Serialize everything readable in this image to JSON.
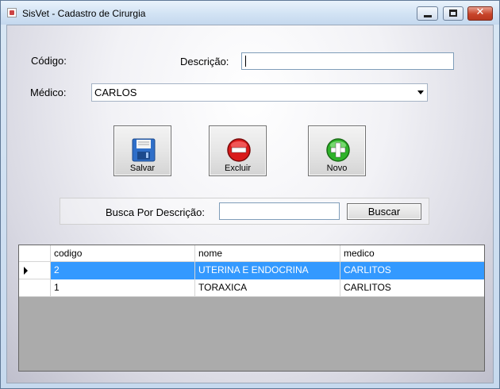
{
  "window": {
    "title": "SisVet - Cadastro de Cirurgia",
    "close_glyph": "✕"
  },
  "form": {
    "codigo_label": "Código:",
    "descricao_label": "Descrição:",
    "descricao_value": "",
    "medico_label": "Médico:",
    "medico_value": "CARLOS"
  },
  "buttons": {
    "salvar": {
      "label": "Salvar",
      "icon": "floppy-disk-icon"
    },
    "excluir": {
      "label": "Excluir",
      "icon": "minus-circle-icon"
    },
    "novo": {
      "label": "Novo",
      "icon": "plus-circle-icon"
    }
  },
  "search": {
    "label": "Busca Por Descrição:",
    "value": "",
    "button_label": "Buscar"
  },
  "grid": {
    "columns": [
      "codigo",
      "nome",
      "medico"
    ],
    "rows": [
      {
        "codigo": "2",
        "nome": "UTERINA E ENDOCRINA",
        "medico": "CARLITOS",
        "selected": true
      },
      {
        "codigo": "1",
        "nome": "TORAXICA",
        "medico": "CARLITOS",
        "selected": false
      }
    ],
    "selection_color": "#3399ff"
  }
}
